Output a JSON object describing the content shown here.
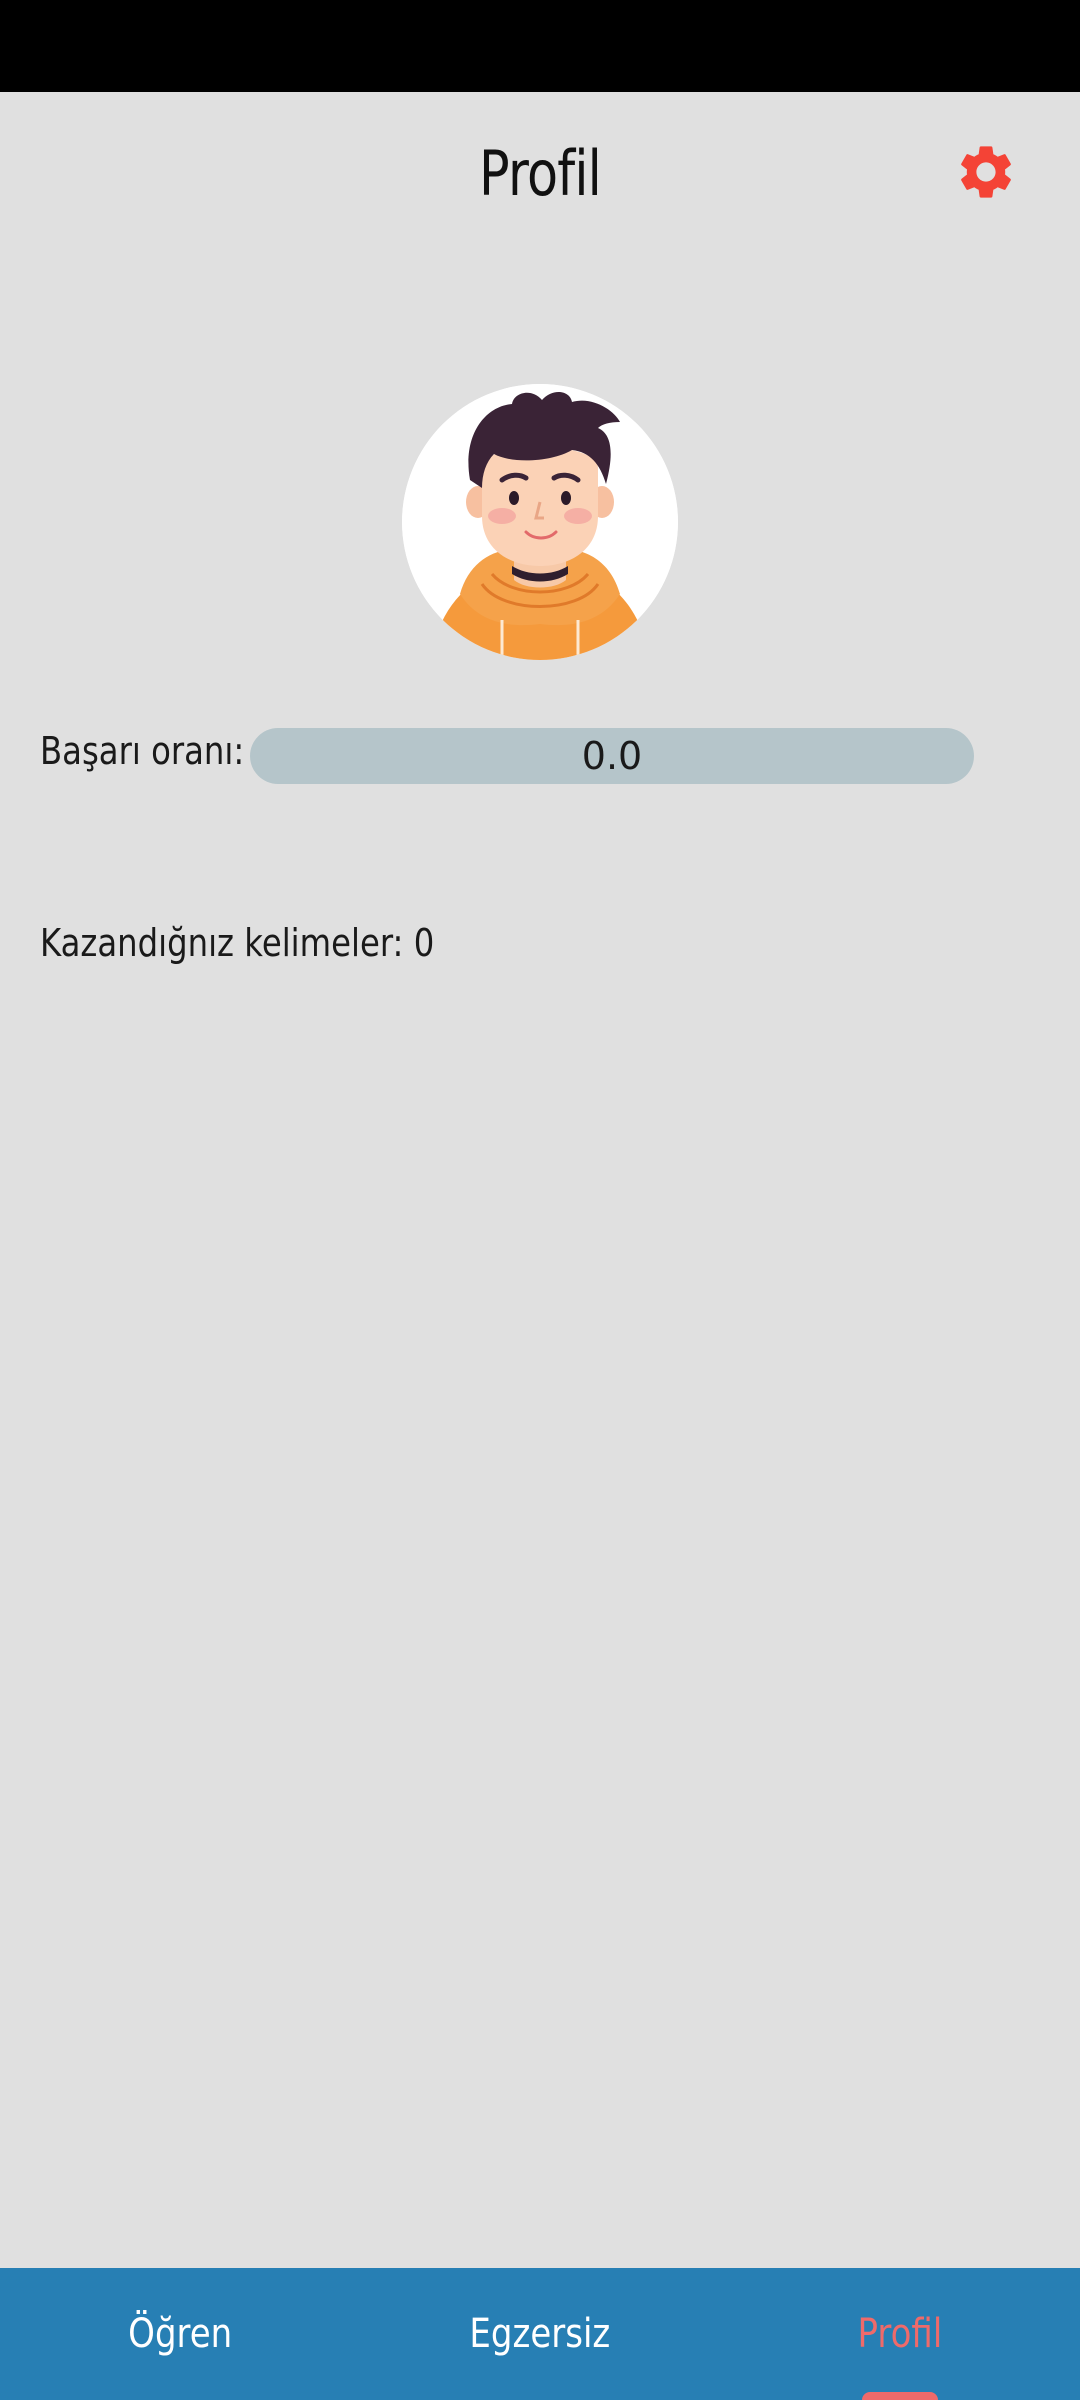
{
  "header": {
    "title": "Profil",
    "settings_icon": "gear-icon",
    "accent_color": "#f44336"
  },
  "profile": {
    "avatar_icon": "user-avatar-illustration",
    "success_label": "Başarı oranı:",
    "success_value_text": "0.0",
    "success_fraction": 0.0,
    "won_words_label": "Kazandığnız kelimeler: 0"
  },
  "bottom_nav": {
    "background": "#277fb4",
    "active_color": "#ef6a6a",
    "tabs": [
      {
        "label": "Öğren",
        "active": false
      },
      {
        "label": "Egzersiz",
        "active": false
      },
      {
        "label": "Profil",
        "active": true
      }
    ]
  }
}
